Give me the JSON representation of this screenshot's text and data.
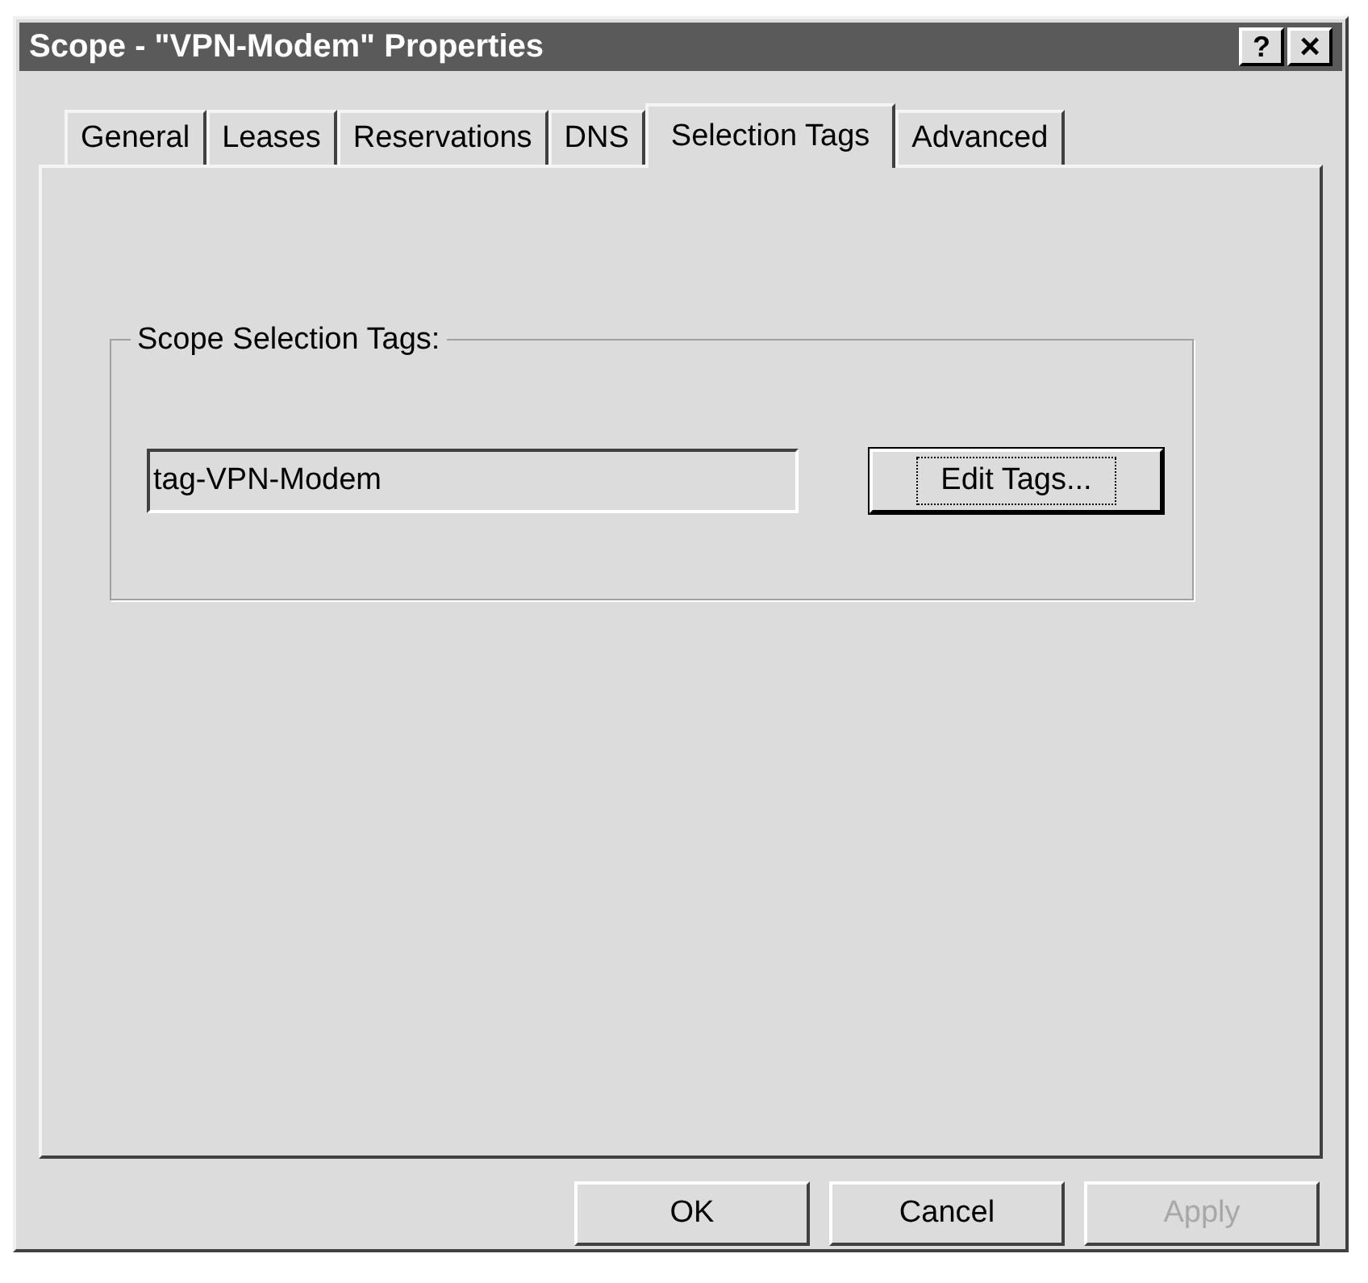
{
  "window": {
    "title": "Scope - \"VPN-Modem\" Properties"
  },
  "title_buttons": [
    {
      "kind": "help",
      "label": "?"
    },
    {
      "kind": "close",
      "label": "×"
    }
  ],
  "tabs": [
    {
      "label": "General",
      "selected": false
    },
    {
      "label": "Leases",
      "selected": false
    },
    {
      "label": "Reservations",
      "selected": false
    },
    {
      "label": "DNS",
      "selected": false
    },
    {
      "label": "Selection Tags",
      "selected": true
    },
    {
      "label": "Advanced",
      "selected": false
    }
  ],
  "group": {
    "label": "Scope Selection Tags:",
    "field_value": "tag-VPN-Modem",
    "button": "Edit Tags..."
  },
  "buttons": [
    {
      "label": "OK",
      "disabled": false
    },
    {
      "label": "Cancel",
      "disabled": false
    },
    {
      "label": "Apply",
      "disabled": true
    }
  ]
}
